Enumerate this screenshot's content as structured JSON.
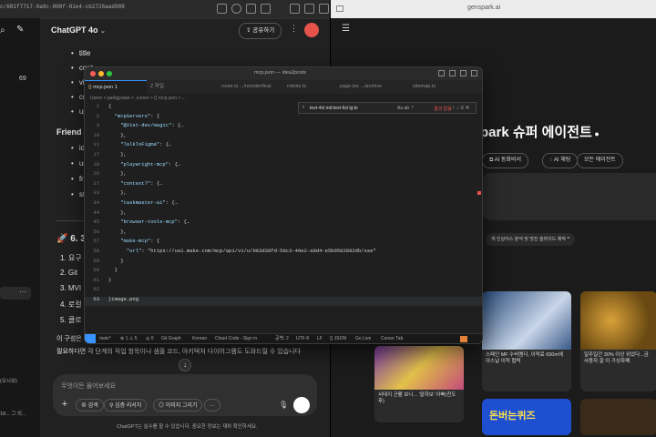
{
  "chat": {
    "url": "c/681f7717-9a9c-800f-81e4-cb2726aad988",
    "model": "ChatGPT 4o",
    "share_label": "공유하기",
    "sidebar_count": "69",
    "bullets_top": [
      "title",
      "cont",
      "visi",
      "crea",
      "upd"
    ],
    "section_friend": "Friend",
    "bullets_friend": [
      "id",
      "use",
      "frie",
      "stat"
    ],
    "section_six": "🚀 6. 3",
    "numbered": [
      "1. 요구",
      "2. Git",
      "3. MVI",
      "4. 로컬",
      "5. 클로"
    ],
    "para1": "이 구성은 기본 구조이며, 더 확장하거나 줄일 수 습니다.",
    "para2": "필요하다면 각 단계의 작업 항목이나 샘플 코드, 아키텍처 다이어그램도 도와드릴 수 있습니다",
    "input_placeholder": "무엇이든 물어보세요",
    "pills": [
      "검색",
      "심층 리서치",
      "이미지 그리기"
    ],
    "disclaimer": "ChatGPT는 실수를 할 수 있습니다. 중요한 정보는 재차 확인하세요.",
    "sidebar_snippets": [
      "(오시보)",
      "18... 그 외..."
    ]
  },
  "browser": {
    "url": "genspark.ai",
    "hero": "park 슈퍼 에이전트",
    "chips": [
      "AI 동화비서",
      "AI 채팅",
      "모든 에이전트"
    ],
    "prompt_hint": "게 인상어스 분석 및 멋진 슬라이드 제작",
    "card_news": [
      "스페인 MF 수비멤디, 이적료 €60m에 아스날 이적 협력",
      "일주일간 30% 이상 위었다...금 사용자 잘 이 가상화폐",
      "서태지 군활 보니... '말하보' 아빠(친도 후)",
      "돈버는퀴즈"
    ]
  },
  "editor": {
    "window_title": "mcp.json — idea2posts",
    "tabs": [
      "mcp.json 1",
      "Z 파일",
      "route.ts .../reorder/feat",
      "robots.ts",
      "page.tsx .../archive",
      "sitemap.ts"
    ],
    "breadcrumb": "Users > parkgyutae > .cursor > {} mcp.json > ...",
    "find_text": "text-4xl md:text-6xl lg:te",
    "find_result": "결과 없음",
    "lines": [
      {
        "n": "1",
        "t": "{"
      },
      {
        "n": "2",
        "t": "  \"mcpServers\": {"
      },
      {
        "n": "3",
        "t": "    \"@21st-dev/magic\": {…"
      },
      {
        "n": "10",
        "t": "    },"
      },
      {
        "n": "11",
        "t": "    \"TalkToFigma\": {…"
      },
      {
        "n": "17",
        "t": "    },"
      },
      {
        "n": "18",
        "t": "    \"playwright-mcp\": {…"
      },
      {
        "n": "26",
        "t": "    },"
      },
      {
        "n": "27",
        "t": "    \"context7\": {…"
      },
      {
        "n": "33",
        "t": "    },"
      },
      {
        "n": "34",
        "t": "    \"taskmaster-ai\": {…"
      },
      {
        "n": "44",
        "t": "    },"
      },
      {
        "n": "45",
        "t": "    \"browser-tools-mcp\": {…"
      },
      {
        "n": "56",
        "t": "    },"
      },
      {
        "n": "57",
        "t": "    \"make-mcp\": {"
      },
      {
        "n": "58",
        "t": "      \"url\": \"https://us1.make.com/mcp/api/v1/u/063d38fd-50c3-40e2-a0d4-e5b9502882db/sse\""
      },
      {
        "n": "59",
        "t": "    }"
      },
      {
        "n": "60",
        "t": "  }"
      },
      {
        "n": "61",
        "t": "}"
      },
      {
        "n": "62",
        "t": ""
      },
      {
        "n": "63",
        "t": "}image.png"
      }
    ],
    "status": [
      "main*",
      "⊗ 1 ⚠ 5",
      "◎ 0",
      "Git Graph",
      "Korean",
      "Cloud Code - Sign in",
      "공백: 2",
      "UTF-8",
      "LF",
      "{} JSON",
      "Go Live",
      "Cursor Tab"
    ]
  },
  "colors": {
    "accent_red": "#e5534b",
    "vscode_blue": "#3794ff"
  }
}
